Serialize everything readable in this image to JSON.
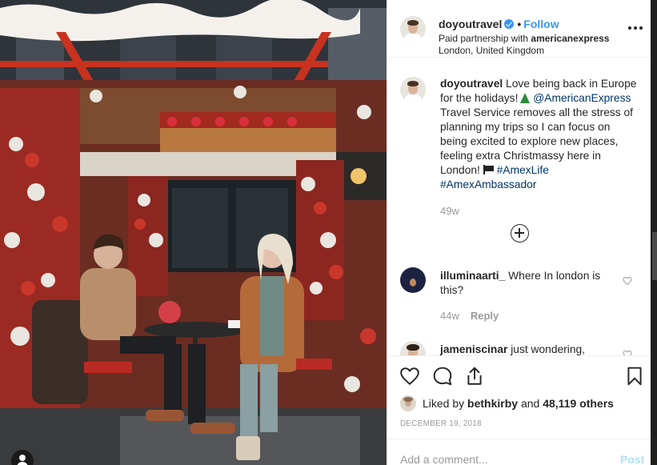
{
  "header": {
    "username": "doyoutravel",
    "separator": "•",
    "follow_label": "Follow",
    "partnership_prefix": "Paid partnership with ",
    "partner": "americanexpress",
    "location": "London, United Kingdom",
    "more_icon": "more-options-icon"
  },
  "caption": {
    "username": "doyoutravel",
    "line1": "Love being back in Europe for the holidays!",
    "emoji1": "christmas-tree-icon",
    "mention": "@AmericanExpress",
    "line2": "Travel Service removes all the stress of planning my trips so I can focus on being excited to explore new places, feeling extra Christmassy here in London!",
    "emoji2": "flag-icon",
    "hashtag1": "#AmexLife",
    "hashtag2": "#AmexAmbassador",
    "time": "49w"
  },
  "comments": [
    {
      "username": "illuminaarti_",
      "text": "Where In london is this?",
      "time": "44w",
      "reply_label": "Reply"
    },
    {
      "username": "jameniscinar",
      "text": "just wondering,"
    }
  ],
  "actions": {
    "liked_by_prefix": "Liked by ",
    "liked_by_user": "bethkirby",
    "liked_by_and": " and ",
    "likes_count": "48,119 others",
    "date": "DECEMBER 19, 2018"
  },
  "add_comment": {
    "placeholder": "Add a comment...",
    "post_label": "Post"
  },
  "colors": {
    "accent": "#3897f0",
    "link": "#003569",
    "muted": "#999999",
    "post_disabled": "#b2dffc"
  }
}
